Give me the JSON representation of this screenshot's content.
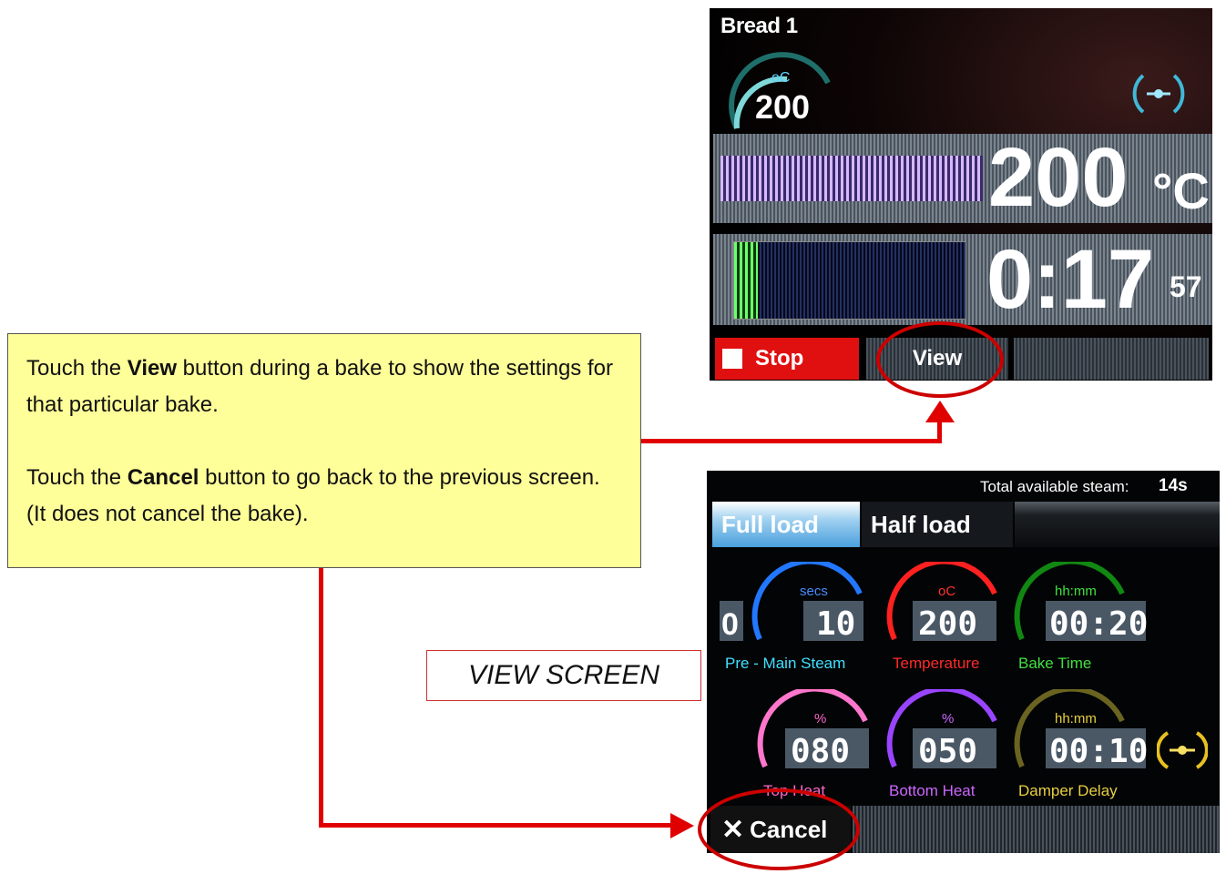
{
  "callout": {
    "p1_pre": "Touch the ",
    "p1_bold": "View",
    "p1_post": " button during a bake to show the settings for that particular bake.",
    "p2_pre": "Touch the ",
    "p2_bold": "Cancel",
    "p2_post": " button to go back to the previous screen. (It does not cancel the bake)."
  },
  "view_screen_label": "VIEW SCREEN",
  "screen1": {
    "title": "Bread 1",
    "dial_unit": "oC",
    "dial_value": "200",
    "temperature": "200",
    "temperature_unit": "°C",
    "time_main": "0:17",
    "time_seconds": "57",
    "stop_label": "Stop",
    "view_label": "View",
    "temperature_bar_fill": 1.0,
    "time_progress_fill": 0.1
  },
  "screen2": {
    "steam_label": "Total available steam:",
    "steam_value": "14s",
    "tabs": [
      "Full load",
      "Half load"
    ],
    "pre_steam_left": "0",
    "params": [
      {
        "unit": "secs",
        "value": "10",
        "label": "Pre - Main Steam",
        "color": "#2277ff"
      },
      {
        "unit": "oC",
        "value": "200",
        "label": "Temperature",
        "color": "#ff2020"
      },
      {
        "unit": "hh:mm",
        "value": "00:20",
        "label": "Bake Time",
        "color": "#22cc22"
      },
      {
        "unit": "%",
        "value": "080",
        "label": "Top Heat",
        "color": "#ff66cc"
      },
      {
        "unit": "%",
        "value": "050",
        "label": "Bottom Heat",
        "color": "#cc66ff"
      },
      {
        "unit": "hh:mm",
        "value": "00:10",
        "label": "Damper Delay",
        "color": "#e8d040"
      }
    ],
    "cancel_label": "Cancel"
  }
}
